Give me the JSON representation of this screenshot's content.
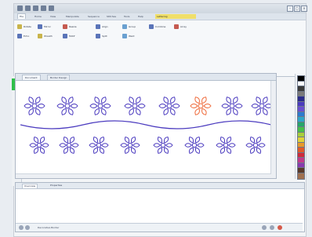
{
  "window": {
    "title": "",
    "controls": [
      "–",
      "□",
      "×"
    ]
  },
  "ribbon_tabs": [
    {
      "label": "File"
    },
    {
      "label": "Home"
    },
    {
      "label": "View"
    },
    {
      "label": "Manipulate"
    },
    {
      "label": "Sequence"
    },
    {
      "label": "Stitches"
    },
    {
      "label": "Tools"
    },
    {
      "label": "Help"
    },
    {
      "label": "Lettering"
    }
  ],
  "ribbon_buttons": [
    {
      "label": "Rotate",
      "color": "#c9b44b"
    },
    {
      "label": "Mirror",
      "color": "#5a74b8"
    },
    {
      "label": "Resize",
      "color": "#c55a50"
    },
    {
      "label": "Align",
      "color": "#5a74b8"
    },
    {
      "label": "Group",
      "color": "#6aa0d0"
    },
    {
      "label": "Combine",
      "color": "#5a74b8"
    },
    {
      "label": "Array",
      "color": "#c55a50"
    },
    {
      "label": "Echo",
      "color": "#5a74b8"
    },
    {
      "label": "Wreath",
      "color": "#c9b44b"
    },
    {
      "label": "Motif",
      "color": "#5a74b8"
    },
    {
      "label": "Split",
      "color": "#5a74b8"
    },
    {
      "label": "Weld",
      "color": "#6aa0d0"
    }
  ],
  "ribbon_group_label": "",
  "doc_tabs": [
    {
      "label": "Document"
    },
    {
      "label": "Border Design"
    }
  ],
  "bottom_tabs": [
    {
      "label": "Overview"
    },
    {
      "label": "Properties"
    }
  ],
  "status": {
    "text": "Decorative Border"
  },
  "palette_colors": [
    "#000000",
    "#ffffff",
    "#3a3a3a",
    "#7a7a7a",
    "#2a2a8a",
    "#4b3bbf",
    "#6a4fd0",
    "#2d7bd0",
    "#2fa6c8",
    "#27a66c",
    "#47c04a",
    "#a8cf3a",
    "#e0d23a",
    "#e89a2a",
    "#e05a2a",
    "#d02a3a",
    "#c23a8a",
    "#8a3ab0",
    "#5a3a2a",
    "#a07050"
  ],
  "design": {
    "stroke_main": "#4b3bbf",
    "stroke_highlight": "#ef6a3a"
  }
}
